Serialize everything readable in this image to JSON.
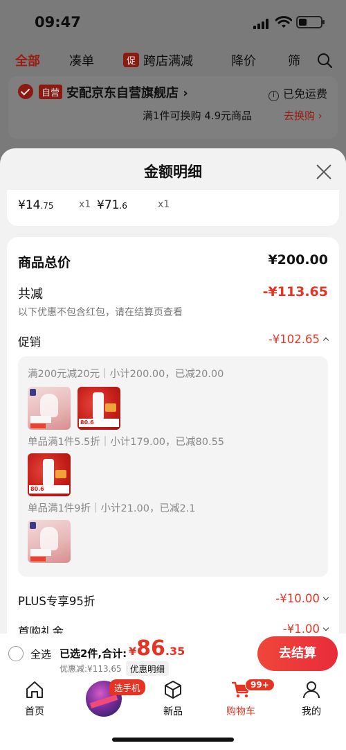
{
  "status_bar": {
    "time": "09:47"
  },
  "top_tabs": [
    {
      "label": "全部",
      "active": true
    },
    {
      "label": "凑单"
    },
    {
      "badge": "促",
      "label": "跨店满减"
    },
    {
      "label": "降价"
    },
    {
      "label": "筛"
    }
  ],
  "store": {
    "badge": "自营",
    "name": "安配京东自营旗舰店 ›",
    "shipping": "已免运费",
    "swap_text": "满1件可换购 4.9元商品",
    "swap_link": "去换购 ›"
  },
  "sheet": {
    "title": "金额明细",
    "products": [
      {
        "currency": "¥",
        "int": "14",
        "dec": ".75",
        "qty": "x1"
      },
      {
        "currency": "¥",
        "int": "71",
        "dec": ".6",
        "qty": "x1"
      }
    ],
    "total_label": "商品总价",
    "total_value": "¥200.00",
    "reduce_label": "共减",
    "reduce_value": "-¥113.65",
    "reduce_note": "以下优惠不包含红包，请在结算页查看",
    "promo_label": "促销",
    "promo_value": "-¥102.65",
    "promo_groups": [
      {
        "text": "满200元减20元｜小计200.00，已减20.00"
      },
      {
        "text": "单品满1件5.5折｜小计179.00，已减80.55"
      },
      {
        "text": "单品满1件9折｜小计21.00，已减2.1"
      }
    ],
    "thumb_price": "80.6",
    "plus_label": "PLUS专享95折",
    "plus_value": "-¥10.00",
    "gift_label": "首购礼金",
    "gift_value": "-¥1.00"
  },
  "checkout": {
    "select_all": "全选",
    "selected": "已选2件,合计:",
    "currency": "¥",
    "amount_int": "86",
    "amount_dec": ".35",
    "discount": "优惠减:¥113.65",
    "detail_link": "优惠明细",
    "button": "去结算"
  },
  "tabbar": {
    "items": [
      {
        "label": "首页",
        "icon": "home-icon"
      },
      {
        "label": "",
        "icon": "promo-circle"
      },
      {
        "label": "新品",
        "icon": "cube-icon"
      },
      {
        "label": "购物车",
        "icon": "cart-icon",
        "active": true
      },
      {
        "label": "我的",
        "icon": "user-icon"
      }
    ],
    "promo_badge": "选手机",
    "cart_badge": "99+"
  },
  "colors": {
    "accent": "#e63424",
    "dim_red": "#9c1b12"
  }
}
